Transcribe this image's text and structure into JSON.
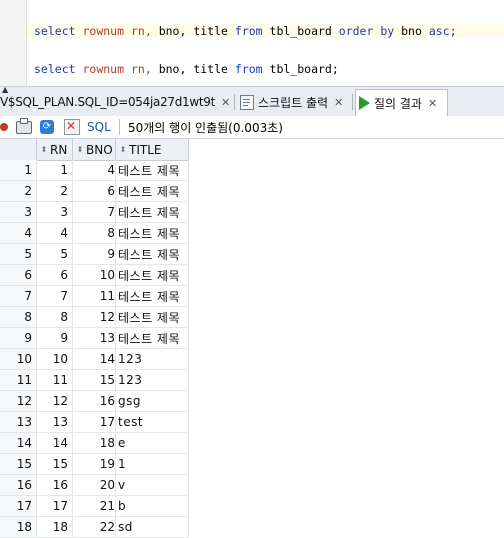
{
  "editor": {
    "line1": {
      "kw1": "select",
      "fn1": "rownum",
      "t1": "rn,",
      "t2": "bno,",
      "t3": "title",
      "kw2": "from",
      "t4": "tbl_board",
      "kw3": "order by",
      "t5": "bno",
      "kw4": "asc;"
    },
    "line2": {
      "kw1": "select",
      "fn1": "rownum",
      "t1": "rn,",
      "t2": "bno,",
      "t3": "title",
      "kw2": "from",
      "t4": "tbl_board;"
    }
  },
  "tabs": [
    {
      "label": "V$SQL_PLAN.SQL_ID=054ja27d1wt9t",
      "icon": "plan-grid-icon"
    },
    {
      "label": "스크립트 출력",
      "icon": "script-output-icon"
    },
    {
      "label": "질의 결과",
      "icon": "run-query-icon"
    }
  ],
  "toolbar": {
    "sql_label": "SQL",
    "status": "50개의 행이 인출됨(0.003초)"
  },
  "grid": {
    "columns": [
      "RN",
      "BNO",
      "TITLE"
    ],
    "rows": [
      {
        "n": "1",
        "rn": "1",
        "bno": "4",
        "title": "테스트 제목"
      },
      {
        "n": "2",
        "rn": "2",
        "bno": "6",
        "title": "테스트 제목"
      },
      {
        "n": "3",
        "rn": "3",
        "bno": "7",
        "title": "테스트 제목"
      },
      {
        "n": "4",
        "rn": "4",
        "bno": "8",
        "title": "테스트 제목"
      },
      {
        "n": "5",
        "rn": "5",
        "bno": "9",
        "title": "테스트 제목"
      },
      {
        "n": "6",
        "rn": "6",
        "bno": "10",
        "title": "테스트 제목"
      },
      {
        "n": "7",
        "rn": "7",
        "bno": "11",
        "title": "테스트 제목"
      },
      {
        "n": "8",
        "rn": "8",
        "bno": "12",
        "title": "테스트 제목"
      },
      {
        "n": "9",
        "rn": "9",
        "bno": "13",
        "title": "테스트 제목"
      },
      {
        "n": "10",
        "rn": "10",
        "bno": "14",
        "title": "123"
      },
      {
        "n": "11",
        "rn": "11",
        "bno": "15",
        "title": "123"
      },
      {
        "n": "12",
        "rn": "12",
        "bno": "16",
        "title": "gsg"
      },
      {
        "n": "13",
        "rn": "13",
        "bno": "17",
        "title": "test"
      },
      {
        "n": "14",
        "rn": "14",
        "bno": "18",
        "title": "e"
      },
      {
        "n": "15",
        "rn": "15",
        "bno": "19",
        "title": "1"
      },
      {
        "n": "16",
        "rn": "16",
        "bno": "20",
        "title": "v"
      },
      {
        "n": "17",
        "rn": "17",
        "bno": "21",
        "title": "b"
      },
      {
        "n": "18",
        "rn": "18",
        "bno": "22",
        "title": "sd"
      }
    ]
  }
}
